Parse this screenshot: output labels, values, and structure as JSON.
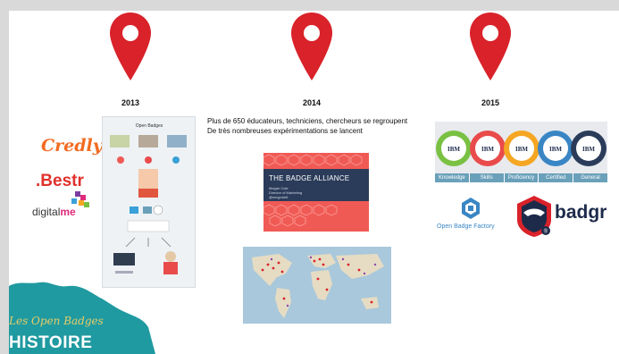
{
  "timeline": {
    "years": [
      "2013",
      "2014",
      "2015"
    ]
  },
  "col2013": {
    "logos": {
      "credly": "Credly",
      "bestr": ".Bestr",
      "digitalme_a": "digital",
      "digitalme_b": "me"
    },
    "infographic_title": "Open Badges"
  },
  "col2014": {
    "intro_line1": "Plus de 650 éducateurs, techniciens, chercheurs se regroupent",
    "intro_line2": "De très nombreuses expérimentations se lancent",
    "alliance_title": "THE BADGE ALLIANCE",
    "alliance_sub1": "Megan Cole",
    "alliance_sub2": "Director of Marketing",
    "alliance_sub3": "@megcole6"
  },
  "col2015": {
    "ibm_badge_text": "IBM",
    "ibm_labels": [
      "Knowledge",
      "Skills",
      "Proficiency",
      "Certified",
      "General"
    ],
    "obf": "Open Badge Factory",
    "badgr": "badgr"
  },
  "footer": {
    "subtitle": "Les Open Badges",
    "title": "HISTOIRE"
  },
  "colors": {
    "pin": "#d9222a",
    "teal": "#1f9aa0",
    "navy": "#2b3c5a",
    "coral": "#f05a55"
  }
}
